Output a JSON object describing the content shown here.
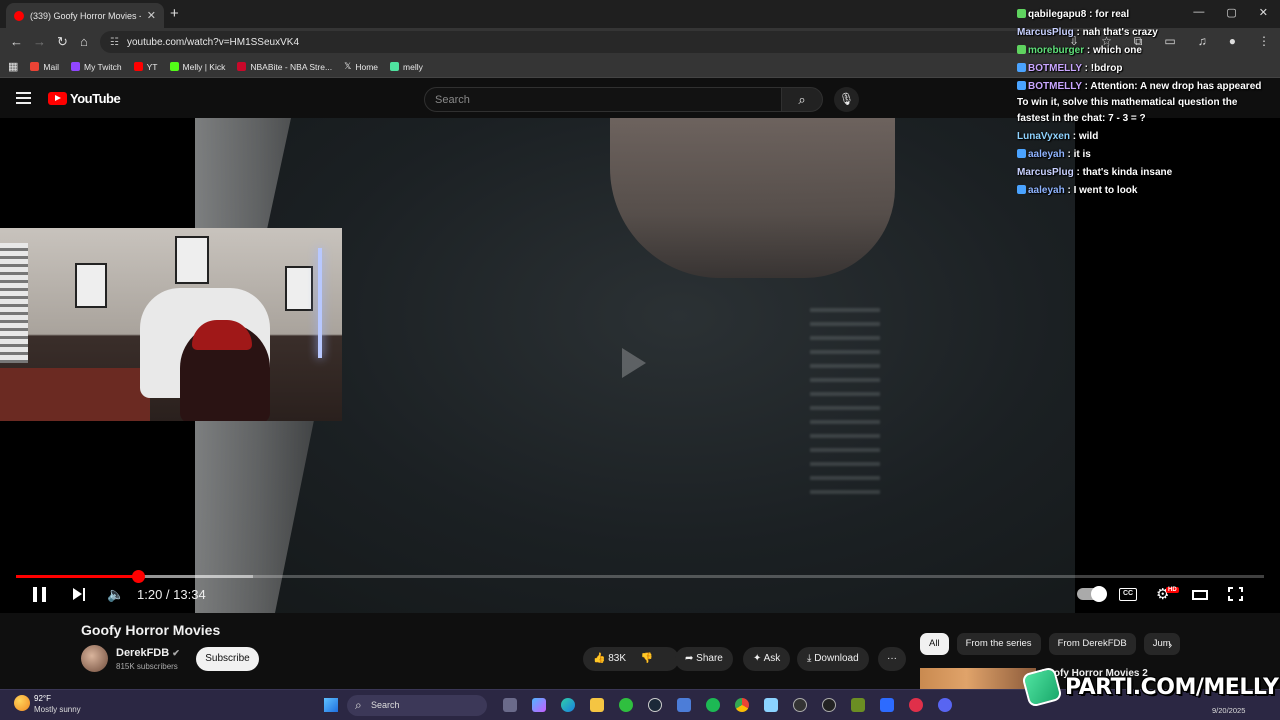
{
  "browser": {
    "tab_title": "(339) Goofy Horror Movies - Yo",
    "tab_close": "✕",
    "new_tab": "+",
    "url": "youtube.com/watch?v=HM1SSeuxVK4",
    "window_controls": [
      "—",
      "▢",
      "✕"
    ],
    "bookmarks": [
      {
        "label": "Mail",
        "color": "#ea4335"
      },
      {
        "label": "My Twitch",
        "color": "#9146ff"
      },
      {
        "label": "YT",
        "color": "#ff0000"
      },
      {
        "label": "Melly | Kick",
        "color": "#53fc18"
      },
      {
        "label": "NBABite - NBA Stre...",
        "color": "#c9082a"
      },
      {
        "label": "Home",
        "color": "#ffffff"
      },
      {
        "label": "melly",
        "color": "#4fe3a0"
      }
    ]
  },
  "youtube": {
    "logo_text": "YouTube",
    "search_placeholder": "Search"
  },
  "player": {
    "current_time": "1:20",
    "duration": "13:34",
    "time_display": "1:20 / 13:34",
    "played_fraction": 0.098,
    "buffered_fraction": 0.19,
    "cc_label": "CC",
    "hd_badge": "HD"
  },
  "video": {
    "title": "Goofy Horror Movies",
    "channel": "DerekFDB",
    "subscribers": "815K subscribers",
    "subscribe_label": "Subscribe",
    "likes": "83K",
    "share_label": "Share",
    "ask_label": "Ask",
    "download_label": "Download",
    "more_label": "···"
  },
  "sidebar": {
    "chips": [
      "All",
      "From the series",
      "From DerekFDB",
      "Jum"
    ],
    "active_chip": "All",
    "rec_title": "Goofy Horror Movies 2"
  },
  "chat": [
    {
      "user": "qabilegapu8",
      "text": "for real",
      "color": "#ffffff",
      "badge": "#5fd35f"
    },
    {
      "user": "MarcusPlug",
      "text": "nah that's crazy",
      "color": "#c8d1ff",
      "badge": ""
    },
    {
      "user": "moreburger",
      "text": "which one",
      "color": "#5fe07a",
      "badge": "#5fd35f"
    },
    {
      "user": "BOTMELLY",
      "text": "!bdrop",
      "color": "#c9a6ff",
      "badge": "#4aa3ff"
    },
    {
      "user": "BOTMELLY",
      "text": "Attention: A new drop has appeared To win it, solve this mathematical question the fastest in the chat: 7 - 3 = ?",
      "color": "#c9a6ff",
      "badge": "#4aa3ff"
    },
    {
      "user": "LunaVyxen",
      "text": "wild",
      "color": "#8fd3ff",
      "badge": ""
    },
    {
      "user": "aaleyah",
      "text": "it is",
      "color": "#8fb4ff",
      "badge": "#4aa3ff"
    },
    {
      "user": "MarcusPlug",
      "text": "that's kinda insane",
      "color": "#c8d1ff",
      "badge": ""
    },
    {
      "user": "aaleyah",
      "text": "I went to look",
      "color": "#8fb4ff",
      "badge": "#4aa3ff"
    }
  ],
  "taskbar": {
    "temperature": "92°F",
    "condition": "Mostly sunny",
    "search_label": "Search",
    "date": "9/20/2025",
    "apps": [
      "files-icon",
      "copilot-icon",
      "edge-icon",
      "folder-icon",
      "xbox-icon",
      "steam-icon",
      "store-icon",
      "spotify-icon",
      "chrome-icon",
      "media-icon",
      "obs-icon",
      "app-icon",
      "minecraft-icon",
      "generic-icon",
      "riot-icon",
      "discord-icon"
    ]
  },
  "overlay": {
    "brand_text": "PARTI.COM/MELLY"
  },
  "colors": {
    "accent": "#ff0000",
    "background": "#0f0f0f",
    "taskbar": "#2b2743"
  }
}
